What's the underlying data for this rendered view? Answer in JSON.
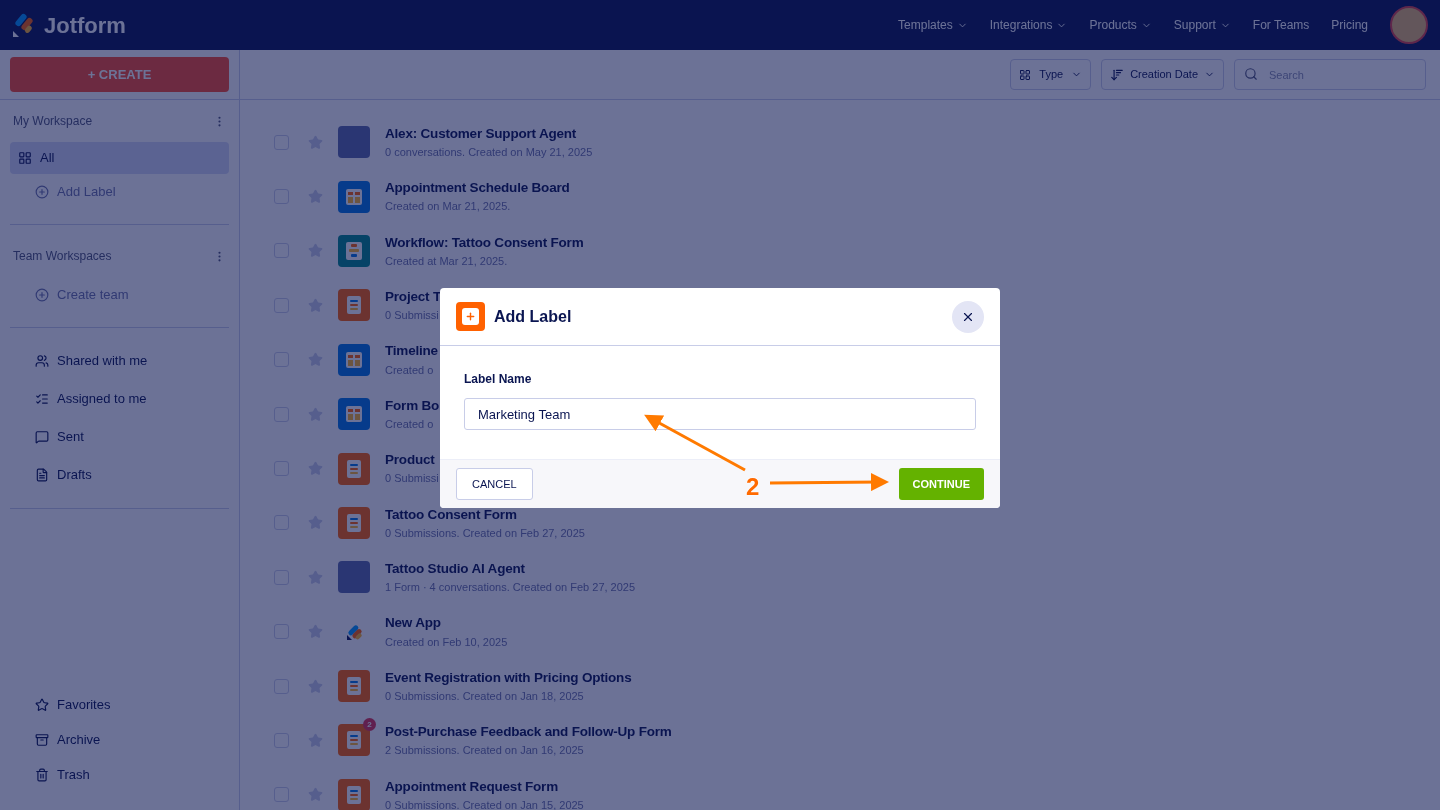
{
  "header": {
    "logo": "Jotform",
    "nav": [
      {
        "label": "Templates",
        "dropdown": true
      },
      {
        "label": "Integrations",
        "dropdown": true
      },
      {
        "label": "Products",
        "dropdown": true
      },
      {
        "label": "Support",
        "dropdown": true
      },
      {
        "label": "For Teams",
        "dropdown": false
      },
      {
        "label": "Pricing",
        "dropdown": false
      }
    ]
  },
  "sidebar": {
    "create": "+ CREATE",
    "my_workspace": "My Workspace",
    "workspace_items": [
      {
        "label": "All",
        "selected": true,
        "kind": "all"
      },
      {
        "label": "Add Label",
        "selected": false,
        "kind": "add"
      }
    ],
    "team_workspaces": "Team Workspaces",
    "create_team": "Create team",
    "items": [
      {
        "label": "Shared with me",
        "kind": "shared"
      },
      {
        "label": "Assigned to me",
        "kind": "assigned"
      },
      {
        "label": "Sent",
        "kind": "sent"
      },
      {
        "label": "Drafts",
        "kind": "drafts"
      }
    ],
    "bottom": [
      {
        "label": "Favorites",
        "kind": "favorites"
      },
      {
        "label": "Archive",
        "kind": "archive"
      },
      {
        "label": "Trash",
        "kind": "trash"
      }
    ]
  },
  "toolbar": {
    "type": "Type",
    "sort": "Creation Date",
    "search_placeholder": "Search"
  },
  "rows": [
    {
      "title": "Alex: Customer Support Agent",
      "subtitle": "0 conversations. Created on May 21, 2025",
      "kind": "agent",
      "checked": false
    },
    {
      "title": "Appointment Schedule Board",
      "subtitle": "Created on Mar 21, 2025.",
      "kind": "board",
      "checked": false
    },
    {
      "title": "Workflow: Tattoo Consent Form",
      "subtitle": "Created at Mar 21, 2025.",
      "kind": "workflow",
      "checked": false
    },
    {
      "title": "Project T",
      "subtitle": "0 Submissi",
      "kind": "form",
      "checked": false
    },
    {
      "title": "Timeline",
      "subtitle": "Created o",
      "kind": "board",
      "checked": false
    },
    {
      "title": "Form Bo",
      "subtitle": "Created o",
      "kind": "board",
      "checked": false
    },
    {
      "title": "Product",
      "subtitle": "0 Submissi",
      "kind": "form",
      "checked": false
    },
    {
      "title": "Tattoo Consent Form",
      "subtitle": "0 Submissions. Created on Feb 27, 2025",
      "kind": "form",
      "checked": false
    },
    {
      "title": "Tattoo Studio AI Agent",
      "subtitle": "1 Form · 4 conversations. Created on Feb 27, 2025",
      "kind": "agent",
      "checked": false
    },
    {
      "title": "New App",
      "subtitle": "Created on Feb 10, 2025",
      "kind": "app",
      "checked": false
    },
    {
      "title": "Event Registration with Pricing Options",
      "subtitle": "0 Submissions. Created on Jan 18, 2025",
      "kind": "form",
      "checked": false
    },
    {
      "title": "Post-Purchase Feedback and Follow-Up Form",
      "subtitle": "2 Submissions. Created on Jan 16, 2025",
      "kind": "form",
      "badge": "2",
      "checked": false
    },
    {
      "title": "Appointment Request Form",
      "subtitle": "0 Submissions. Created on Jan 15, 2025",
      "kind": "form",
      "checked": false
    }
  ],
  "dialog": {
    "title": "Add Label",
    "field_label": "Label Name",
    "value": "Marketing Team",
    "cancel": "CANCEL",
    "continue": "CONTINUE"
  },
  "annotation": {
    "step": "2"
  }
}
